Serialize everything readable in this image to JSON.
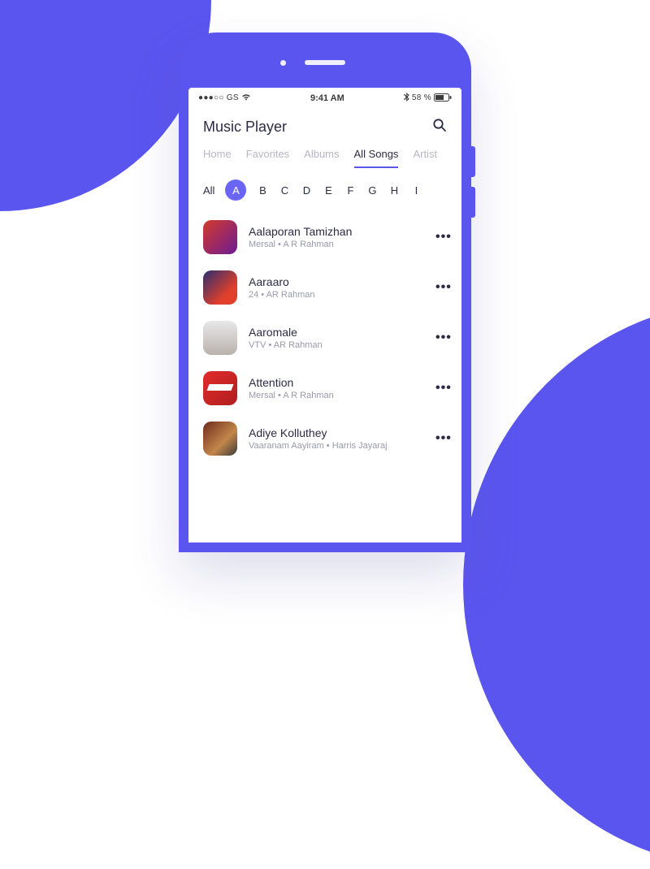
{
  "status": {
    "signal": "●●●○○",
    "carrier": "GS",
    "time": "9:41 AM",
    "battery_pct": "58 %"
  },
  "header": {
    "title": "Music Player"
  },
  "tabs": [
    {
      "label": "Home",
      "active": false
    },
    {
      "label": "Favorites",
      "active": false
    },
    {
      "label": "Albums",
      "active": false
    },
    {
      "label": "All Songs",
      "active": true
    },
    {
      "label": "Artist",
      "active": false
    }
  ],
  "alpha": {
    "all": "All",
    "letters": [
      "A",
      "B",
      "C",
      "D",
      "E",
      "F",
      "G",
      "H",
      "I"
    ],
    "selected": "A"
  },
  "songs": [
    {
      "title": "Aalaporan Tamizhan",
      "subtitle": "Mersal • A R Rahman"
    },
    {
      "title": "Aaraaro",
      "subtitle": "24 • AR Rahman"
    },
    {
      "title": "Aaromale",
      "subtitle": "VTV • AR Rahman"
    },
    {
      "title": "Attention",
      "subtitle": "Mersal • A R Rahman"
    },
    {
      "title": "Adiye Kolluthey",
      "subtitle": "Vaaranam Aayiram • Harris Jayaraj"
    }
  ],
  "glyphs": {
    "more": "•••"
  }
}
